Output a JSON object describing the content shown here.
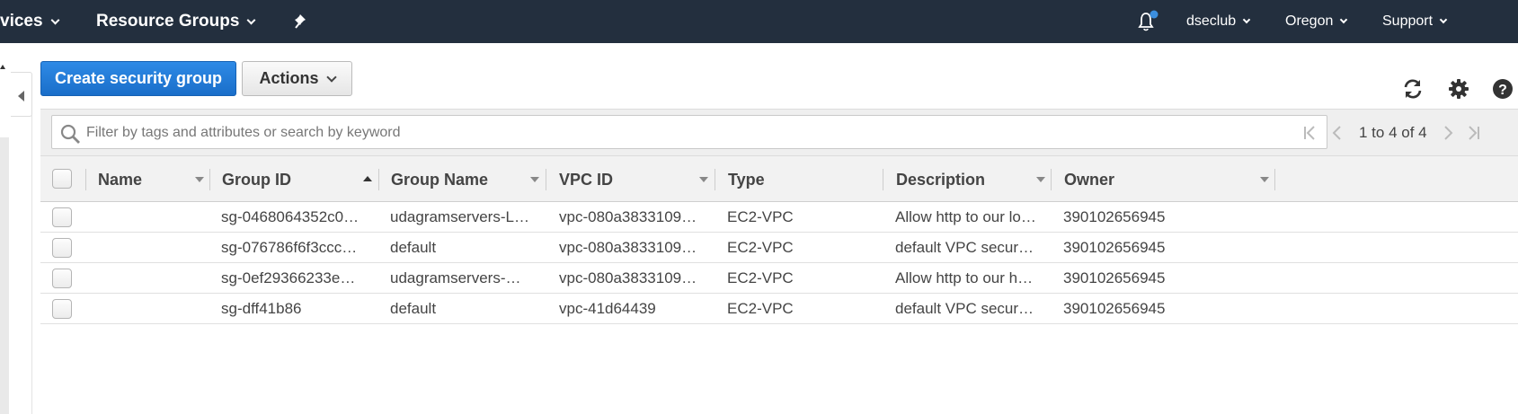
{
  "topnav": {
    "services_label": "vices",
    "resource_groups_label": "Resource Groups",
    "account_label": "dseclub",
    "region_label": "Oregon",
    "support_label": "Support"
  },
  "toolbar": {
    "create_label": "Create security group",
    "actions_label": "Actions"
  },
  "search": {
    "placeholder": "Filter by tags and attributes or search by keyword"
  },
  "pagination": {
    "text": "1 to 4 of 4"
  },
  "table": {
    "columns": [
      "Name",
      "Group ID",
      "Group Name",
      "VPC ID",
      "Type",
      "Description",
      "Owner"
    ],
    "sorted_column": "Group ID",
    "rows": [
      {
        "name": "",
        "group_id": "sg-0468064352c0…",
        "group_name": "udagramservers-L…",
        "vpc_id": "vpc-080a3833109…",
        "type": "EC2-VPC",
        "description": "Allow http to our lo…",
        "owner": "390102656945"
      },
      {
        "name": "",
        "group_id": "sg-076786f6f3ccc…",
        "group_name": "default",
        "vpc_id": "vpc-080a3833109…",
        "type": "EC2-VPC",
        "description": "default VPC secur…",
        "owner": "390102656945"
      },
      {
        "name": "",
        "group_id": "sg-0ef29366233e…",
        "group_name": "udagramservers-…",
        "vpc_id": "vpc-080a3833109…",
        "type": "EC2-VPC",
        "description": "Allow http to our h…",
        "owner": "390102656945"
      },
      {
        "name": "",
        "group_id": "sg-dff41b86",
        "group_name": "default",
        "vpc_id": "vpc-41d64439",
        "type": "EC2-VPC",
        "description": "default VPC secur…",
        "owner": "390102656945"
      }
    ]
  },
  "icons": {
    "pin": "pin-icon",
    "bell": "bell-icon",
    "refresh": "refresh-icon",
    "settings": "gear-icon",
    "help": "help-icon",
    "search": "search-icon"
  },
  "colors": {
    "nav_bg": "#232f3e",
    "primary": "#1a6ec9",
    "notification_dot": "#3b8fe0"
  }
}
